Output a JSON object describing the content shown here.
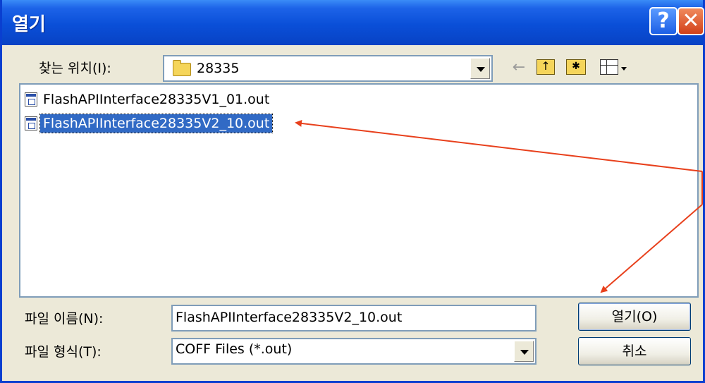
{
  "window": {
    "title": "열기"
  },
  "title_buttons": {
    "help": "?",
    "close": "✕"
  },
  "look_in": {
    "label": "찾는 위치(I):",
    "value": "28335"
  },
  "toolbar": {
    "back": "←",
    "up": "↑",
    "new_folder": "✱"
  },
  "files": [
    {
      "name": "FlashAPIInterface28335V1_01.out",
      "selected": false
    },
    {
      "name": "FlashAPIInterface28335V2_10.out",
      "selected": true
    }
  ],
  "file_name": {
    "label": "파일 이름(N):",
    "value": "FlashAPIInterface28335V2_10.out"
  },
  "file_type": {
    "label": "파일 형식(T):",
    "value": "COFF Files (*.out)"
  },
  "buttons": {
    "open": "열기(O)",
    "cancel": "취소"
  },
  "annotation": {
    "arrow_color": "#e8401c"
  },
  "colors": {
    "titlebar": "#0a4fd8",
    "dialog_bg": "#ece9d8",
    "selection": "#316ac5"
  }
}
